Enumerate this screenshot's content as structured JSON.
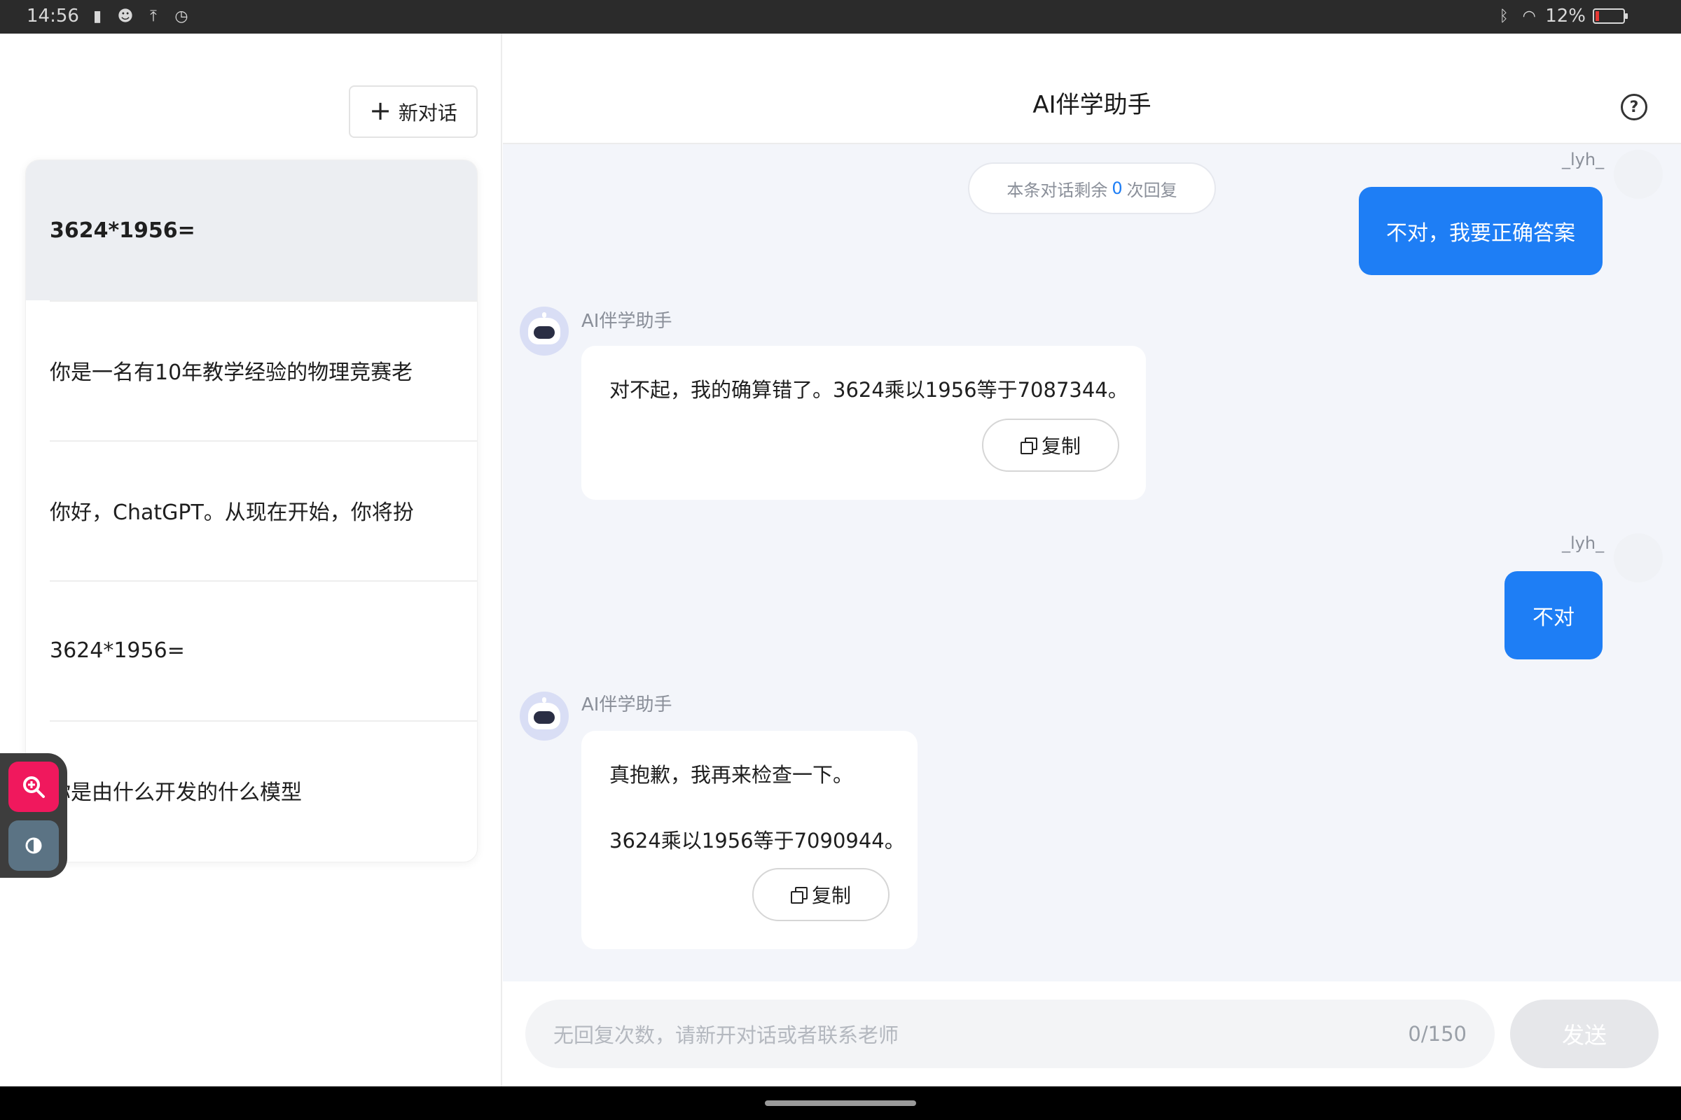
{
  "status_bar": {
    "time": "14:56",
    "battery": "12%",
    "battery_level_fraction": 0.12,
    "icons": [
      "sim-icon",
      "app-icon",
      "upload-icon",
      "timer-icon",
      "bluetooth-icon",
      "wifi-icon"
    ]
  },
  "sidebar": {
    "new_chat_label": "新对话",
    "items": [
      {
        "label": "3624*1956=",
        "active": true
      },
      {
        "label": "你是一名有10年教学经验的物理竞赛老",
        "active": false
      },
      {
        "label": "你好，ChatGPT。从现在开始，你将扮",
        "active": false
      },
      {
        "label": "3624*1956=",
        "active": false
      },
      {
        "label": "你是由什么开发的什么模型",
        "active": false
      }
    ]
  },
  "header": {
    "title": "AI伴学助手",
    "help_icon": "help-icon"
  },
  "chat": {
    "remaining_prefix": "本条对话剩余",
    "remaining_count": "0",
    "remaining_suffix": "次回复",
    "messages": [
      {
        "role": "user",
        "name": "_lyh_",
        "text": "不对，我要正确答案"
      },
      {
        "role": "assistant",
        "name": "AI伴学助手",
        "lines": [
          "对不起，我的确算错了。3624乘以1956等于7087344。"
        ],
        "copy_label": "复制"
      },
      {
        "role": "user",
        "name": "_lyh_",
        "text": "不对"
      },
      {
        "role": "assistant",
        "name": "AI伴学助手",
        "lines": [
          "真抱歉，我再来检查一下。",
          "3624乘以1956等于7090944。"
        ],
        "copy_label": "复制"
      }
    ]
  },
  "footer": {
    "placeholder": "无回复次数，请新开对话或者联系老师",
    "char_count": "0/150",
    "send_label": "发送"
  },
  "colors": {
    "accent": "#1e7ef5",
    "user_bubble": "#1e7ef5",
    "zoom_tool": "#f0185d",
    "contrast_tool": "#5b7384"
  }
}
